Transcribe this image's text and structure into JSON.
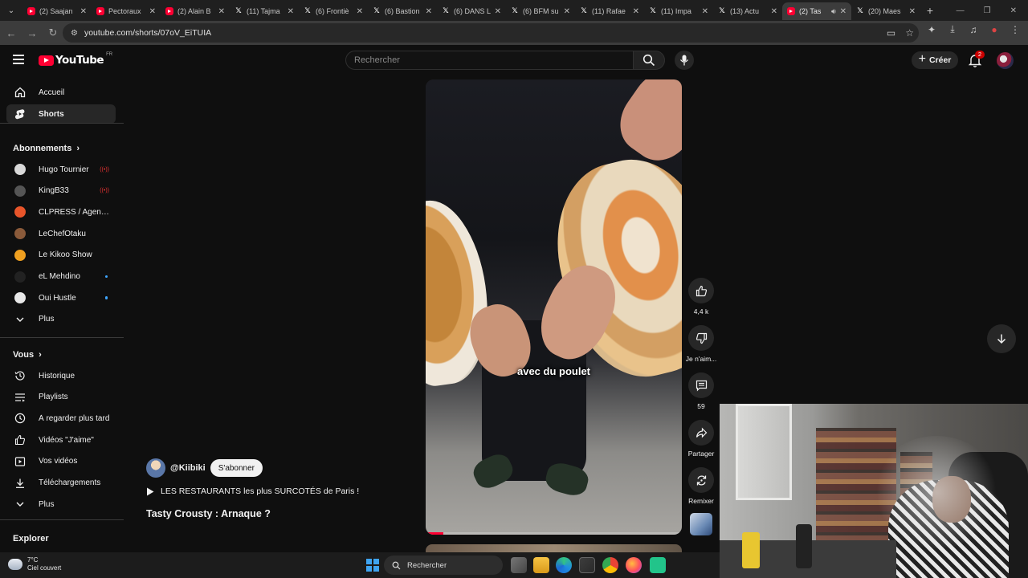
{
  "browser": {
    "tabs": [
      {
        "label": "(2) Saajan",
        "icon": "youtube"
      },
      {
        "label": "Pectoraux",
        "icon": "youtube"
      },
      {
        "label": "(2) Alain B",
        "icon": "youtube"
      },
      {
        "label": "(11) Tajma",
        "icon": "x"
      },
      {
        "label": "(6) Frontiè",
        "icon": "x"
      },
      {
        "label": "(6) Bastion",
        "icon": "x"
      },
      {
        "label": "(6) DANS L",
        "icon": "x"
      },
      {
        "label": "(6) BFM su",
        "icon": "x"
      },
      {
        "label": "(11) Rafae",
        "icon": "x"
      },
      {
        "label": "(11) Impa",
        "icon": "x"
      },
      {
        "label": "(13) Actu",
        "icon": "x"
      },
      {
        "label": "(2) Tas",
        "icon": "youtube",
        "active": true
      },
      {
        "label": "(20) Maes",
        "icon": "x"
      }
    ],
    "url": "youtube.com/shorts/07oV_EiTUIA"
  },
  "masthead": {
    "logo_text": "YouTube",
    "country_code": "FR",
    "search_placeholder": "Rechercher",
    "create_label": "Créer",
    "notification_count": "2"
  },
  "sidebar": {
    "main": [
      {
        "label": "Accueil",
        "icon": "home-icon"
      },
      {
        "label": "Shorts",
        "icon": "shorts-icon",
        "active": true
      }
    ],
    "subscriptions_heading": "Abonnements",
    "subscriptions": [
      {
        "label": "Hugo Tournier",
        "live": true,
        "color": "#d9d9d9"
      },
      {
        "label": "KingB33",
        "live": true,
        "color": "#555555"
      },
      {
        "label": "CLPRESS / Agence ...",
        "color": "#e8552a"
      },
      {
        "label": "LeChefOtaku",
        "color": "#8a5a3a"
      },
      {
        "label": "Le Kikoo Show",
        "color": "#f0a020"
      },
      {
        "label": "eL Mehdino",
        "dot": true,
        "color": "#222222"
      },
      {
        "label": "Oui Hustle",
        "dot": true,
        "color": "#e8e8e8"
      },
      {
        "label": "Plus",
        "icon": "chevron-down-icon"
      }
    ],
    "you_heading": "Vous",
    "you_items": [
      {
        "label": "Historique",
        "icon": "history-icon"
      },
      {
        "label": "Playlists",
        "icon": "playlists-icon"
      },
      {
        "label": "À regarder plus tard",
        "icon": "watch-later-icon"
      },
      {
        "label": "Vidéos \"J'aime\"",
        "icon": "liked-icon"
      },
      {
        "label": "Vos vidéos",
        "icon": "your-videos-icon"
      },
      {
        "label": "Téléchargements",
        "icon": "downloads-icon"
      },
      {
        "label": "Plus",
        "icon": "chevron-down-icon"
      }
    ],
    "explore_heading": "Explorer"
  },
  "short": {
    "caption": "avec du poulet",
    "channel": "@Kiibiki",
    "subscribe_label": "S'abonner",
    "playlist_label": "LES RESTAURANTS les plus SURCOTÉS de Paris !",
    "title": "Tasty Crousty : Arnaque ?",
    "progress_fraction": 0.07
  },
  "actions": {
    "likes": "4,4 k",
    "dislike_label": "Je n'aim...",
    "comments": "59",
    "share_label": "Partager",
    "remix_label": "Remixer"
  },
  "taskbar": {
    "temperature": "7°C",
    "weather": "Ciel couvert",
    "search_label": "Rechercher"
  },
  "colors": {
    "youtube_red": "#ff0033",
    "page_bg": "#0f0f0f",
    "chip_bg": "#272727"
  }
}
